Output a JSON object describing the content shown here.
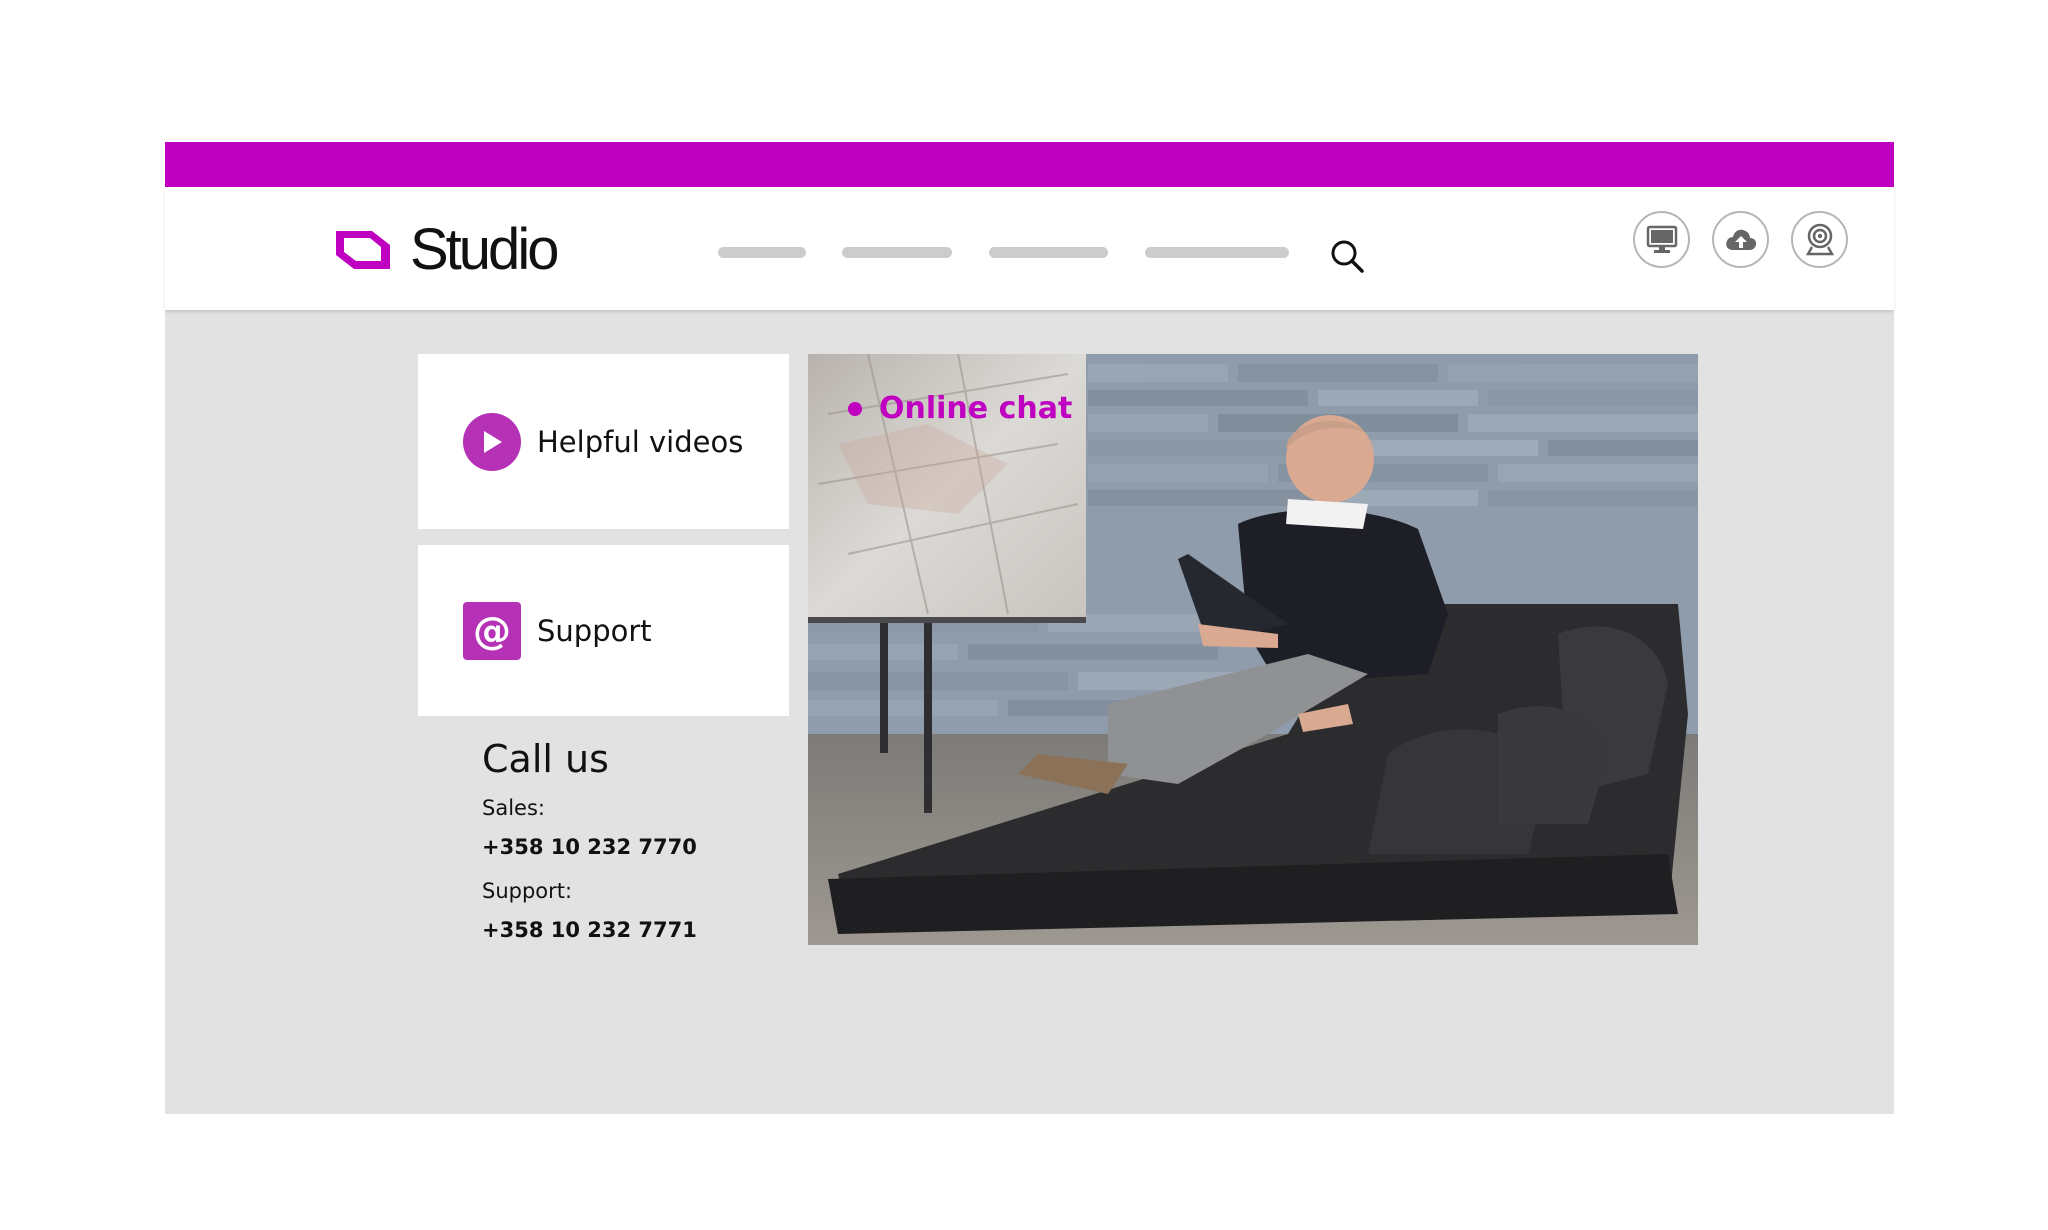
{
  "brand": {
    "name": "Studio",
    "accent_color": "#c000c0",
    "icon_color": "#b531b5"
  },
  "header": {
    "nav_placeholders": 4,
    "search_icon": "search-icon",
    "action_icons": [
      "monitor-icon",
      "cloud-upload-icon",
      "webcam-icon"
    ]
  },
  "cards": {
    "videos": {
      "label": "Helpful videos",
      "icon": "play-icon"
    },
    "support": {
      "label": "Support",
      "icon": "at-sign-icon"
    }
  },
  "call_us": {
    "title": "Call us",
    "sales_label": "Sales:",
    "sales_phone": "+358 10 232 7770",
    "support_label": "Support:",
    "support_phone": "+358 10 232 7771"
  },
  "hero": {
    "chat_label": "Online chat",
    "image_subject": "man sitting on a leather sofa with a laptop, smiling"
  }
}
